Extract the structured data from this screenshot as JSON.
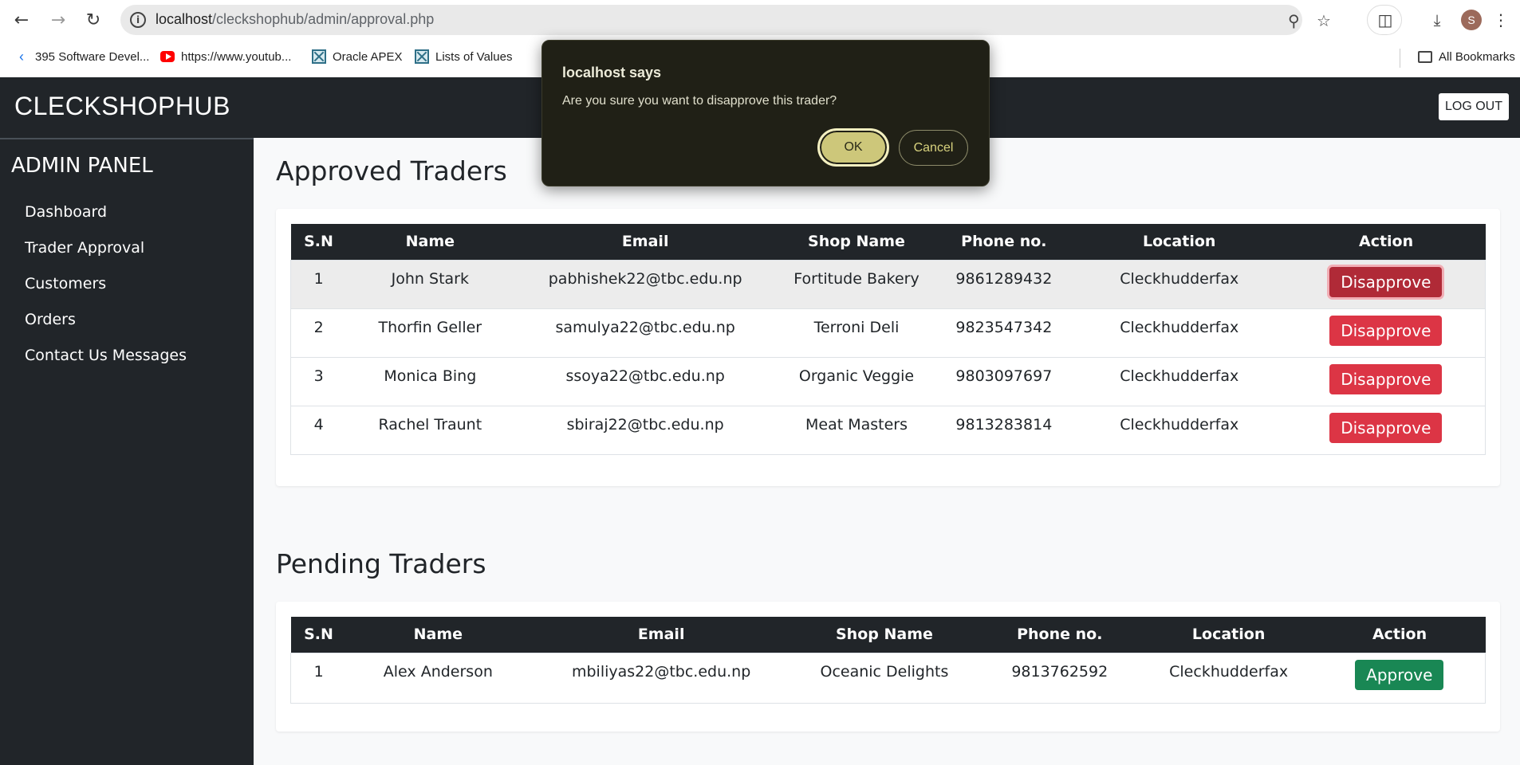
{
  "browser": {
    "url_host": "localhost",
    "url_path": "/cleckshophub/admin/approval.php",
    "profile_initial": "S",
    "bookmarks": [
      "395 Software Devel...",
      "https://www.youtub...",
      "Oracle APEX",
      "Lists of Values"
    ],
    "all_bookmarks": "All Bookmarks"
  },
  "header": {
    "brand": "CLECKSHOPHUB",
    "logout": "LOG OUT"
  },
  "sidebar": {
    "title": "ADMIN PANEL",
    "items": [
      "Dashboard",
      "Trader Approval",
      "Customers",
      "Orders",
      "Contact Us Messages"
    ]
  },
  "approved": {
    "title": "Approved Traders",
    "columns": [
      "S.N",
      "Name",
      "Email",
      "Shop Name",
      "Phone no.",
      "Location",
      "Action"
    ],
    "rows": [
      {
        "sn": "1",
        "name": "John Stark",
        "email": "pabhishek22@tbc.edu.np",
        "shop": "Fortitude Bakery",
        "phone": "9861289432",
        "location": "Cleckhudderfax",
        "action": "Disapprove"
      },
      {
        "sn": "2",
        "name": "Thorfin Geller",
        "email": "samulya22@tbc.edu.np",
        "shop": "Terroni Deli",
        "phone": "9823547342",
        "location": "Cleckhudderfax",
        "action": "Disapprove"
      },
      {
        "sn": "3",
        "name": "Monica Bing",
        "email": "ssoya22@tbc.edu.np",
        "shop": "Organic Veggie",
        "phone": "9803097697",
        "location": "Cleckhudderfax",
        "action": "Disapprove"
      },
      {
        "sn": "4",
        "name": "Rachel Traunt",
        "email": "sbiraj22@tbc.edu.np",
        "shop": "Meat Masters",
        "phone": "9813283814",
        "location": "Cleckhudderfax",
        "action": "Disapprove"
      }
    ]
  },
  "pending": {
    "title": "Pending Traders",
    "columns": [
      "S.N",
      "Name",
      "Email",
      "Shop Name",
      "Phone no.",
      "Location",
      "Action"
    ],
    "rows": [
      {
        "sn": "1",
        "name": "Alex Anderson",
        "email": "mbiliyas22@tbc.edu.np",
        "shop": "Oceanic Delights",
        "phone": "9813762592",
        "location": "Cleckhudderfax",
        "action": "Approve"
      }
    ]
  },
  "dialog": {
    "title": "localhost says",
    "message": "Are you sure you want to disapprove this trader?",
    "ok": "OK",
    "cancel": "Cancel"
  }
}
